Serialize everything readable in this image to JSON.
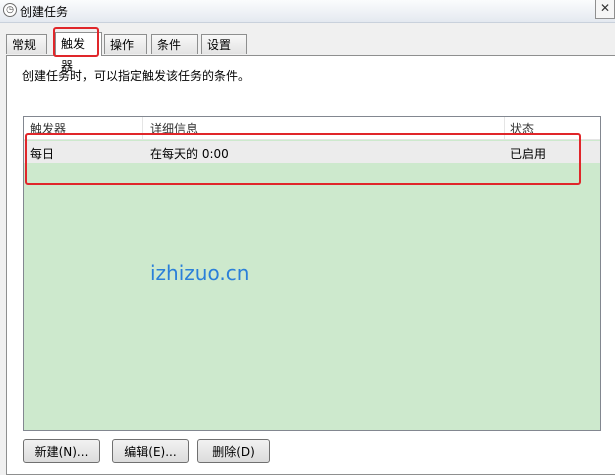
{
  "window": {
    "title": "创建任务",
    "close_glyph": "✕"
  },
  "tabs": [
    "常规",
    "触发器",
    "操作",
    "条件",
    "设置"
  ],
  "active_tab": "触发器",
  "description": "创建任务时，可以指定触发该任务的条件。",
  "table": {
    "columns": [
      "触发器",
      "详细信息",
      "状态"
    ],
    "rows": [
      {
        "trigger": "每日",
        "details": "在每天的 0:00",
        "status": "已启用"
      }
    ]
  },
  "watermark": "izhizuo.cn",
  "buttons": {
    "new": "新建(N)...",
    "edit": "编辑(E)...",
    "delete": "删除(D)"
  },
  "colors": {
    "highlight_red": "#e0262a",
    "list_bg": "#cde9cd",
    "watermark_blue": "#2a7fd9"
  }
}
